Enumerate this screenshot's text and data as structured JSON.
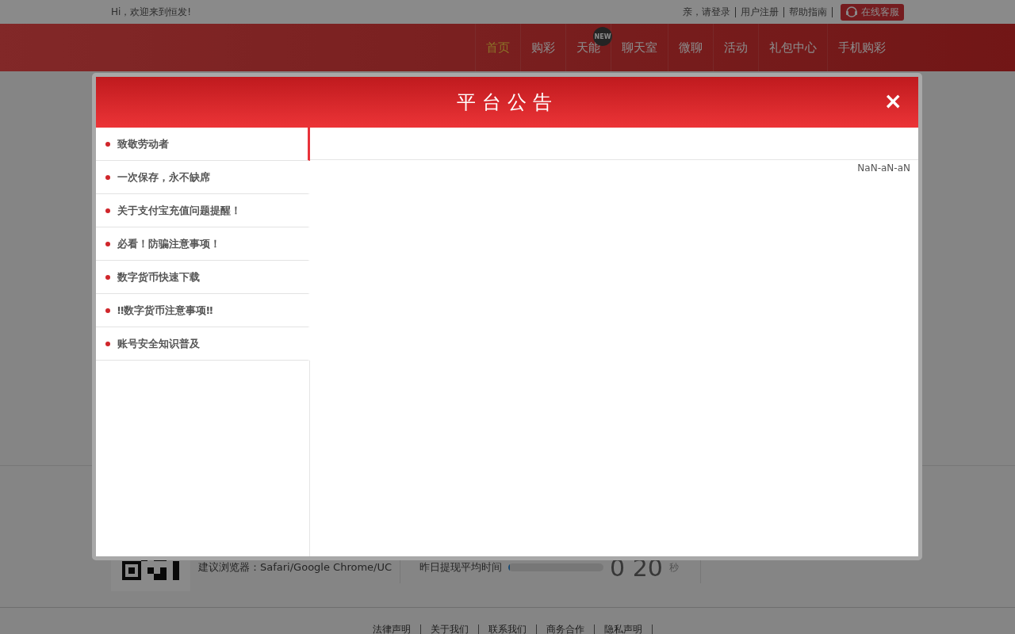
{
  "top_bar": {
    "greeting": "Hi，欢迎来到恒发!",
    "links": [
      "亲，请登录",
      "用户注册",
      "帮助指南"
    ],
    "service_button": "在线客服"
  },
  "nav": [
    {
      "label": "首页",
      "selected": true
    },
    {
      "label": "购彩",
      "selected": false
    },
    {
      "label": "天能",
      "selected": false,
      "badge": "NEW"
    },
    {
      "label": "聊天室",
      "selected": false
    },
    {
      "label": "微聊",
      "selected": false
    },
    {
      "label": "活动",
      "selected": false
    },
    {
      "label": "礼包中心",
      "selected": false
    },
    {
      "label": "手机购彩",
      "selected": false
    }
  ],
  "info_strip": {
    "browser_tip": "建议浏览器：Safari/Google Chrome/UC",
    "withdraw_label": "昨日提现平均时间",
    "withdraw_progress": {
      "level": 0.02
    },
    "withdraw_time": "0 20",
    "withdraw_unit": "秒"
  },
  "footer_links": [
    "法律声明",
    "关于我们",
    "联系我们",
    "商务合作",
    "隐私声明"
  ],
  "modal": {
    "title": "平台公告",
    "close": "×",
    "notices": [
      {
        "title": "致敬劳动者",
        "selected": true
      },
      {
        "title": "一次保存，永不缺席",
        "selected": false
      },
      {
        "title": "关于支付宝充值问题提醒！",
        "selected": false
      },
      {
        "title": "必看！防骗注意事项！",
        "selected": false
      },
      {
        "title": "数字货币快速下载",
        "selected": false
      },
      {
        "title": "‼数字货币注意事项‼",
        "selected": false
      },
      {
        "title": "账号安全知识普及",
        "selected": false
      }
    ],
    "date": "NaN-aN-aN"
  }
}
